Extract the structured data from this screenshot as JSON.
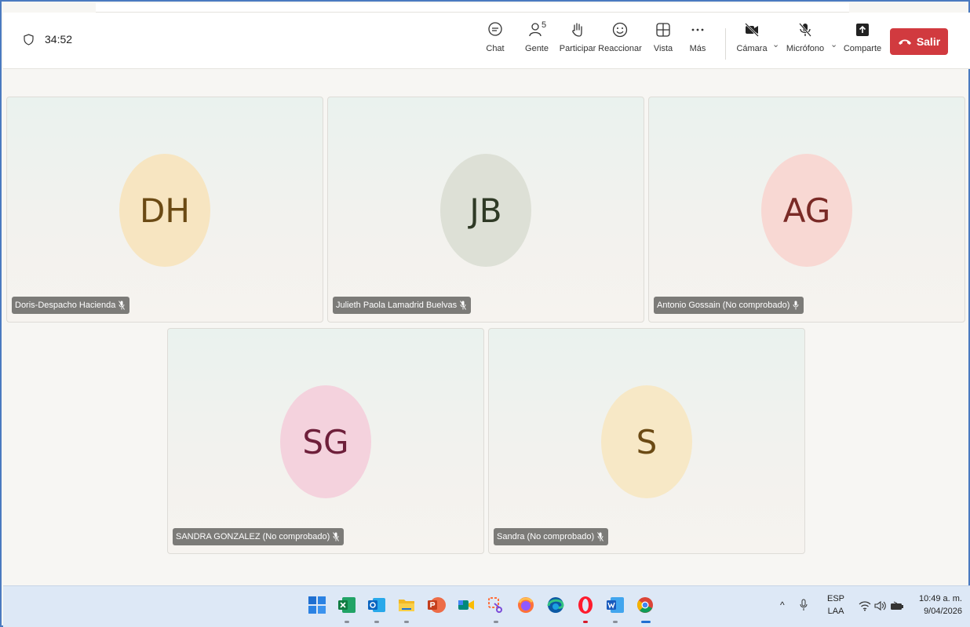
{
  "header": {
    "timer": "34:52",
    "people_count": "5",
    "tools": {
      "chat": "Chat",
      "people": "Gente",
      "raise": "Participar",
      "react": "Reaccionar",
      "view": "Vista",
      "more": "Más",
      "camera": "Cámara",
      "mic": "Micrófono",
      "share": "Comparte"
    },
    "leave_label": "Salir",
    "leave_color": "#d13a3f"
  },
  "participants": [
    {
      "initials": "DH",
      "name": "Doris-Despacho Hacienda",
      "avatar_bg": "#f7e5c1",
      "avatar_fg": "#6b4a14",
      "mic": "muted"
    },
    {
      "initials": "JB",
      "name": "Julieth Paola Lamadrid Buelvas",
      "avatar_bg": "#dde0d6",
      "avatar_fg": "#2f3a26",
      "mic": "muted"
    },
    {
      "initials": "AG",
      "name": "Antonio Gossain (No comprobado)",
      "avatar_bg": "#f8d8d3",
      "avatar_fg": "#7a2a26",
      "mic": "on"
    },
    {
      "initials": "SG",
      "name": "SANDRA GONZALEZ (No comprobado)",
      "avatar_bg": "#f4d2dd",
      "avatar_fg": "#6e1f3a",
      "mic": "muted"
    },
    {
      "initials": "S",
      "name": "Sandra (No comprobado)",
      "avatar_bg": "#f7e8c6",
      "avatar_fg": "#6b4a14",
      "mic": "muted"
    }
  ],
  "taskbar": {
    "apps": [
      "start-icon",
      "excel-icon",
      "outlook-icon",
      "file-explorer-icon",
      "powerpoint-icon",
      "meet-icon",
      "snipping-tool-icon",
      "firefox-icon",
      "edge-icon",
      "opera-icon",
      "word-icon",
      "chrome-icon"
    ],
    "lang_top": "ESP",
    "lang_bottom": "LAA",
    "time": "10:49 a. m.",
    "date": "9/04/2026"
  }
}
